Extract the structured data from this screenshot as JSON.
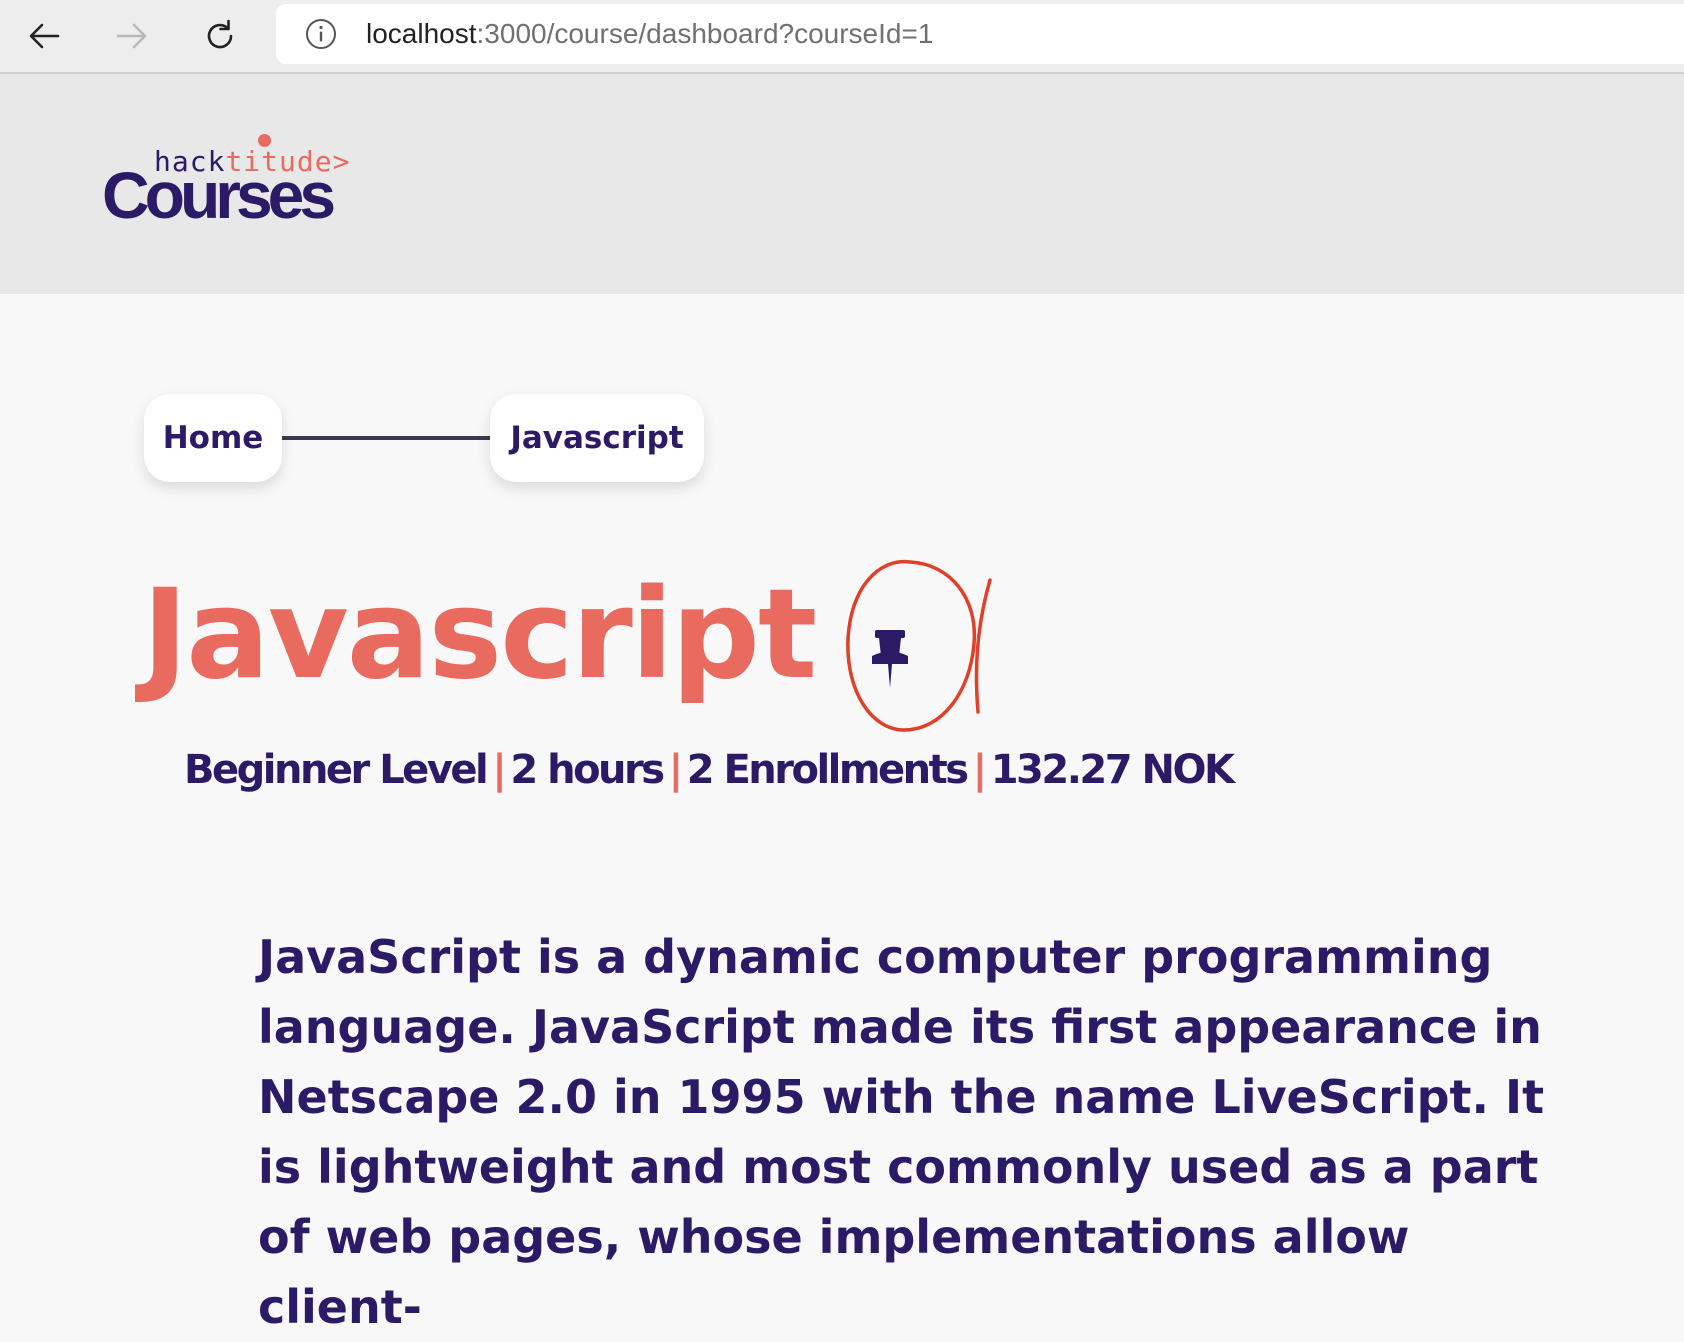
{
  "browser": {
    "url_host": "localhost",
    "url_rest": ":3000/course/dashboard?courseId=1"
  },
  "header": {
    "logo_small_part1": "hack",
    "logo_small_part2": "titude>",
    "logo_big": "Courses",
    "logo_small_color": "#e96a5f",
    "brand_color": "#2b1a66"
  },
  "breadcrumb": {
    "home": "Home",
    "current": "Javascript"
  },
  "course": {
    "title": "Javascript",
    "pin_icon": "pushpin-icon",
    "level": "Beginner Level",
    "duration": "2 hours",
    "enrollments": "2 Enrollments",
    "price": "132.27 NOK",
    "separator": "|",
    "description": "JavaScript is a dynamic computer programming language. JavaScript made its first appearance in Netscape 2.0 in 1995 with the name LiveScript. It is lightweight and most commonly used as a part of web pages, whose implementations allow client-"
  },
  "colors": {
    "accent": "#e96a5f",
    "text": "#2b1a66",
    "annotation": "#e0402a"
  }
}
